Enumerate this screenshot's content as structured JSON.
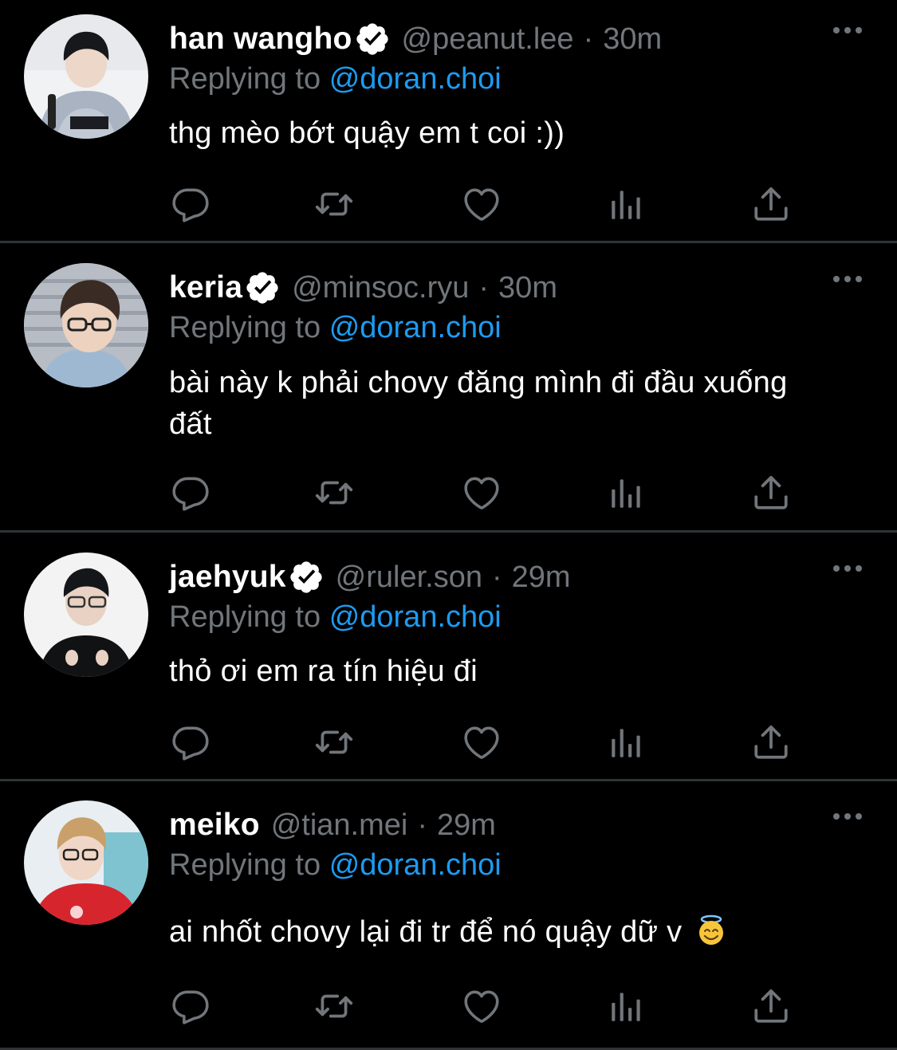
{
  "theme": {
    "background": "#000000",
    "divider": "#2f3336",
    "muted": "#71767b",
    "accent": "#1d9bf0",
    "text": "#ffffff"
  },
  "reply_prefix": "Replying to",
  "tweets": [
    {
      "name": "han wangho",
      "verified": true,
      "handle": "@peanut.lee",
      "separator": "·",
      "time": "30m",
      "reply_to": "@doran.choi",
      "text": "thg mèo bớt quậy em t coi :))",
      "icons": [
        "reply-icon",
        "retweet-icon",
        "like-icon",
        "views-icon",
        "share-icon",
        "more-icon"
      ]
    },
    {
      "name": "keria",
      "verified": true,
      "handle": "@minsoc.ryu",
      "separator": "·",
      "time": "30m",
      "reply_to": "@doran.choi",
      "text": "bài này k phải chovy đăng mình đi đầu xuống đất",
      "icons": [
        "reply-icon",
        "retweet-icon",
        "like-icon",
        "views-icon",
        "share-icon",
        "more-icon"
      ]
    },
    {
      "name": "jaehyuk",
      "verified": true,
      "handle": "@ruler.son",
      "separator": "·",
      "time": "29m",
      "reply_to": "@doran.choi",
      "text": "thỏ ơi em ra tín hiệu đi",
      "icons": [
        "reply-icon",
        "retweet-icon",
        "like-icon",
        "views-icon",
        "share-icon",
        "more-icon"
      ]
    },
    {
      "name": "meiko",
      "verified": false,
      "handle": "@tian.mei",
      "separator": "·",
      "time": "29m",
      "reply_to": "@doran.choi",
      "text": "ai nhốt chovy lại đi tr để nó quậy dữ v",
      "emoji": "smiling-face-with-halo",
      "icons": [
        "reply-icon",
        "retweet-icon",
        "like-icon",
        "views-icon",
        "share-icon",
        "more-icon"
      ]
    }
  ]
}
